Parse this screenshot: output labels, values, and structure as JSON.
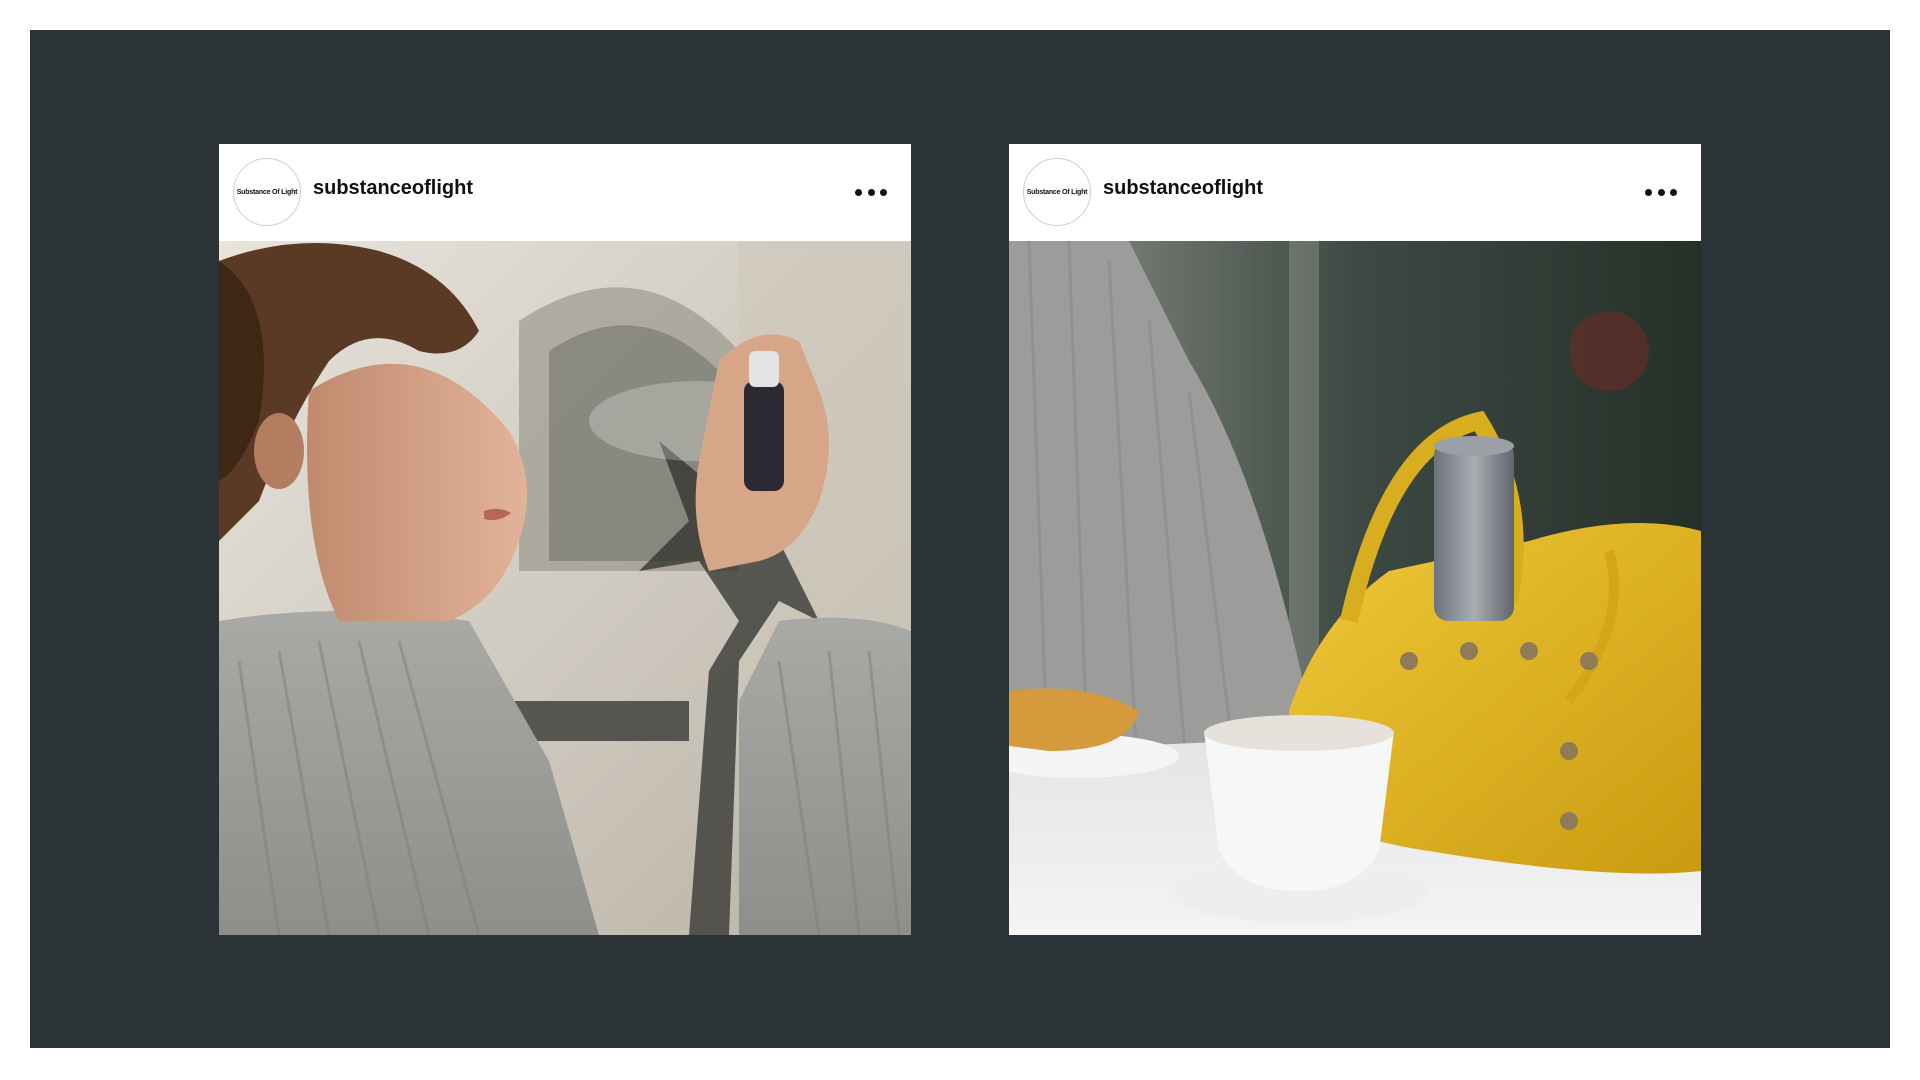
{
  "posts": [
    {
      "account": "substanceoflight",
      "avatar_logo_text": "Substance Of Light",
      "menu_icon": "more-horizontal-icon",
      "photo": "man-spraying-fragrance"
    },
    {
      "account": "substanceoflight",
      "avatar_logo_text": "Substance Of Light",
      "menu_icon": "more-horizontal-icon",
      "photo": "yellow-bag-with-bottle"
    }
  ],
  "colors": {
    "background": "#2c3336",
    "card": "#ffffff",
    "bag": "#e0b51c"
  }
}
